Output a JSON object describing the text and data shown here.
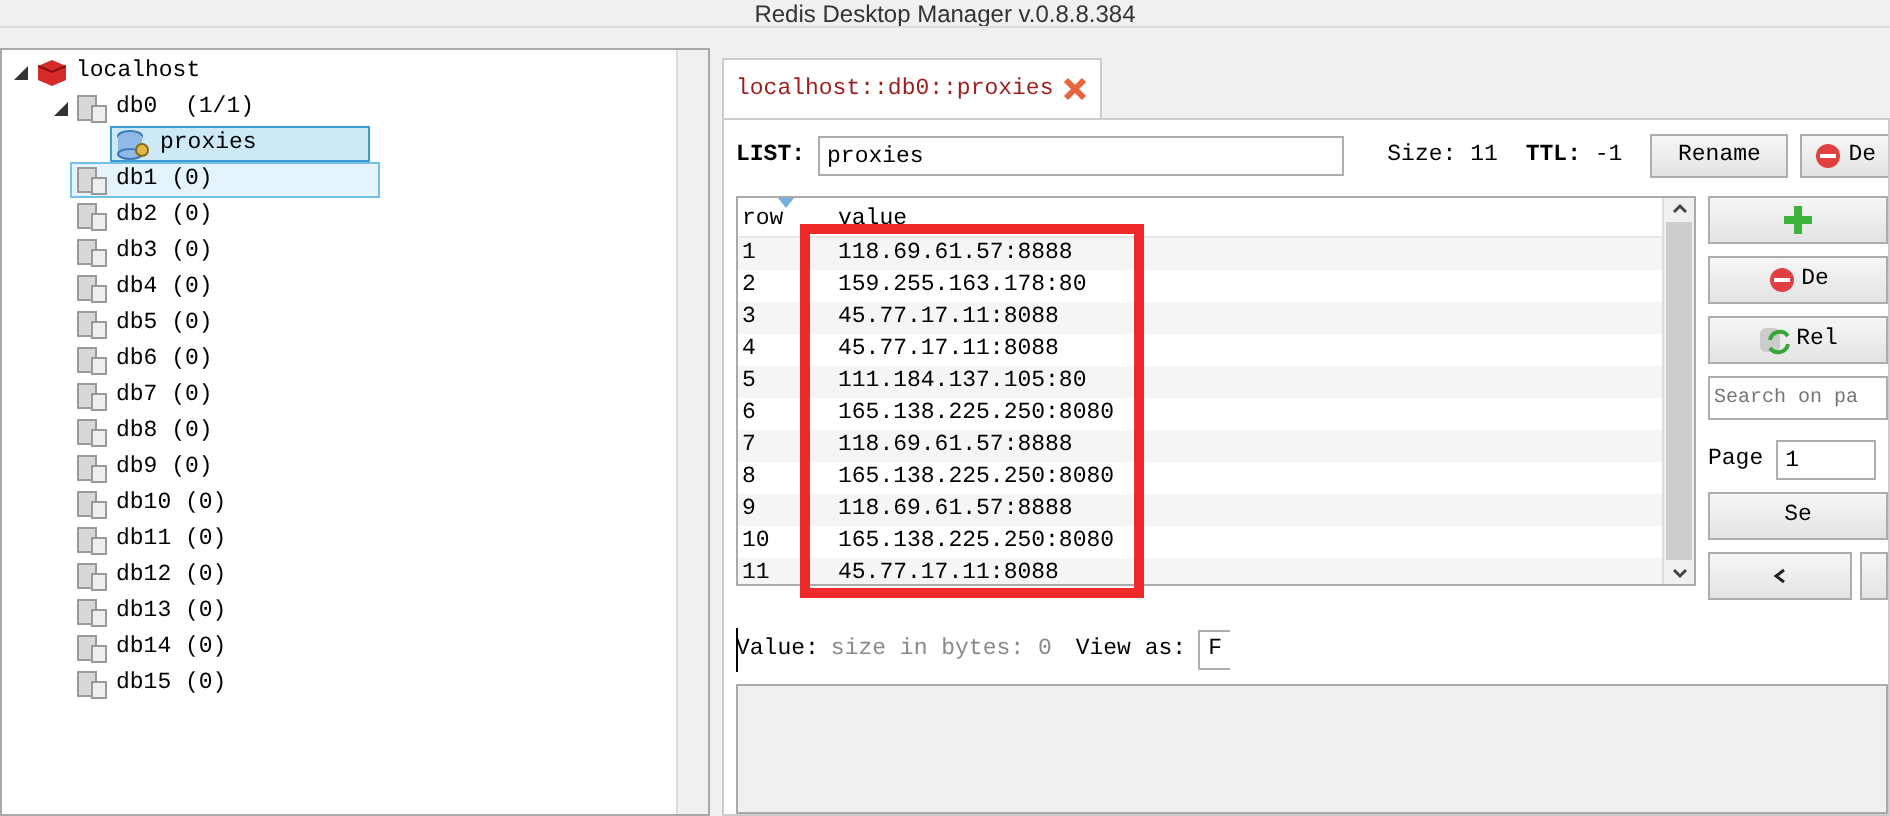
{
  "window": {
    "title": "Redis Desktop Manager v.0.8.8.384"
  },
  "tree": [
    {
      "label": "localhost",
      "kind": "server",
      "expanded": true,
      "selected": false,
      "hovered": false,
      "children": [
        {
          "label": "db0  (1/1)",
          "kind": "db",
          "expanded": true,
          "selected": false,
          "hovered": false,
          "children": [
            {
              "label": "proxies",
              "kind": "key",
              "selected": true,
              "hovered": false
            }
          ]
        },
        {
          "label": "db1 (0)",
          "kind": "db",
          "selected": false,
          "hovered": true
        },
        {
          "label": "db2 (0)",
          "kind": "db",
          "selected": false,
          "hovered": false
        },
        {
          "label": "db3 (0)",
          "kind": "db",
          "selected": false,
          "hovered": false
        },
        {
          "label": "db4 (0)",
          "kind": "db",
          "selected": false,
          "hovered": false
        },
        {
          "label": "db5 (0)",
          "kind": "db",
          "selected": false,
          "hovered": false
        },
        {
          "label": "db6 (0)",
          "kind": "db",
          "selected": false,
          "hovered": false
        },
        {
          "label": "db7 (0)",
          "kind": "db",
          "selected": false,
          "hovered": false
        },
        {
          "label": "db8 (0)",
          "kind": "db",
          "selected": false,
          "hovered": false
        },
        {
          "label": "db9 (0)",
          "kind": "db",
          "selected": false,
          "hovered": false
        },
        {
          "label": "db10 (0)",
          "kind": "db",
          "selected": false,
          "hovered": false
        },
        {
          "label": "db11 (0)",
          "kind": "db",
          "selected": false,
          "hovered": false
        },
        {
          "label": "db12 (0)",
          "kind": "db",
          "selected": false,
          "hovered": false
        },
        {
          "label": "db13 (0)",
          "kind": "db",
          "selected": false,
          "hovered": false
        },
        {
          "label": "db14 (0)",
          "kind": "db",
          "selected": false,
          "hovered": false
        },
        {
          "label": "db15 (0)",
          "kind": "db",
          "selected": false,
          "hovered": false
        }
      ]
    }
  ],
  "tabs": [
    {
      "label": "localhost::db0::proxies",
      "selected": true
    }
  ],
  "key": {
    "type_label": "LIST:",
    "name": "proxies",
    "size_label": "Size:",
    "size": "11",
    "ttl_label": "TTL:",
    "ttl": "-1",
    "rename": "Rename",
    "delete": "De"
  },
  "table": {
    "columns": [
      "row",
      "value"
    ],
    "rows": [
      [
        "1",
        "118.69.61.57:8888"
      ],
      [
        "2",
        "159.255.163.178:80"
      ],
      [
        "3",
        "45.77.17.11:8088"
      ],
      [
        "4",
        "45.77.17.11:8088"
      ],
      [
        "5",
        "111.184.137.105:80"
      ],
      [
        "6",
        "165.138.225.250:8080"
      ],
      [
        "7",
        "118.69.61.57:8888"
      ],
      [
        "8",
        "165.138.225.250:8080"
      ],
      [
        "9",
        "118.69.61.57:8888"
      ],
      [
        "10",
        "165.138.225.250:8080"
      ],
      [
        "11",
        "45.77.17.11:8088"
      ]
    ]
  },
  "side": {
    "delete": "De",
    "reload": "Rel",
    "search_placeholder": "Search on pa",
    "page_label": "Page",
    "page": "1",
    "set": "Se"
  },
  "value": {
    "label": "Value:",
    "info": "size in bytes: 0",
    "view_as_label": "View as:",
    "view_as": "F"
  }
}
